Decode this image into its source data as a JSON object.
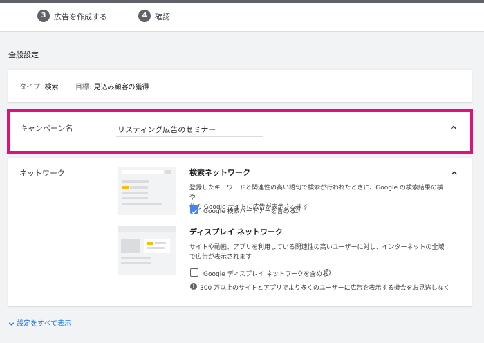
{
  "stepper": {
    "steps": [
      {
        "number": "3",
        "label": "広告を作成する"
      },
      {
        "number": "4",
        "label": "確認"
      }
    ]
  },
  "settings": {
    "section_title": "全般設定",
    "type_label": "タイプ:",
    "type_value": "検索",
    "goal_label": "目標:",
    "goal_value": "見込み顧客の獲得"
  },
  "campaign": {
    "label": "キャンペーン名",
    "value": "リスティング広告のセミナー"
  },
  "network": {
    "label": "ネットワーク",
    "search": {
      "title": "検索ネットワーク",
      "desc_line1": "登録したキーワードと関連性の高い語句で検索が行われたときに、Google の検索結果の横や",
      "desc_line2": "他の Google サイトに広告が表示されます",
      "checkbox_label": "Google 検索パートナーを含める",
      "checked": true
    },
    "display": {
      "title": "ディスプレイ ネットワーク",
      "desc_line1": "サイトや動画、アプリを利用している関連性の高いユーザーに対し、インターネットの全域",
      "desc_line2": "で広告が表示されます",
      "checkbox_label": "Google ディスプレイ ネットワークを含める",
      "checked": false,
      "info": "300 万以上のサイトとアプリでより多くのユーザーに広告を表示する機会をお見逃しなく"
    }
  },
  "footer": {
    "show_all_label": "設定をすべて表示"
  },
  "colors": {
    "accent": "#1a73e8",
    "highlight_border": "#e0107d",
    "checkbox_on": "#4285f4",
    "illustration_yellow": "#fbbc04"
  }
}
